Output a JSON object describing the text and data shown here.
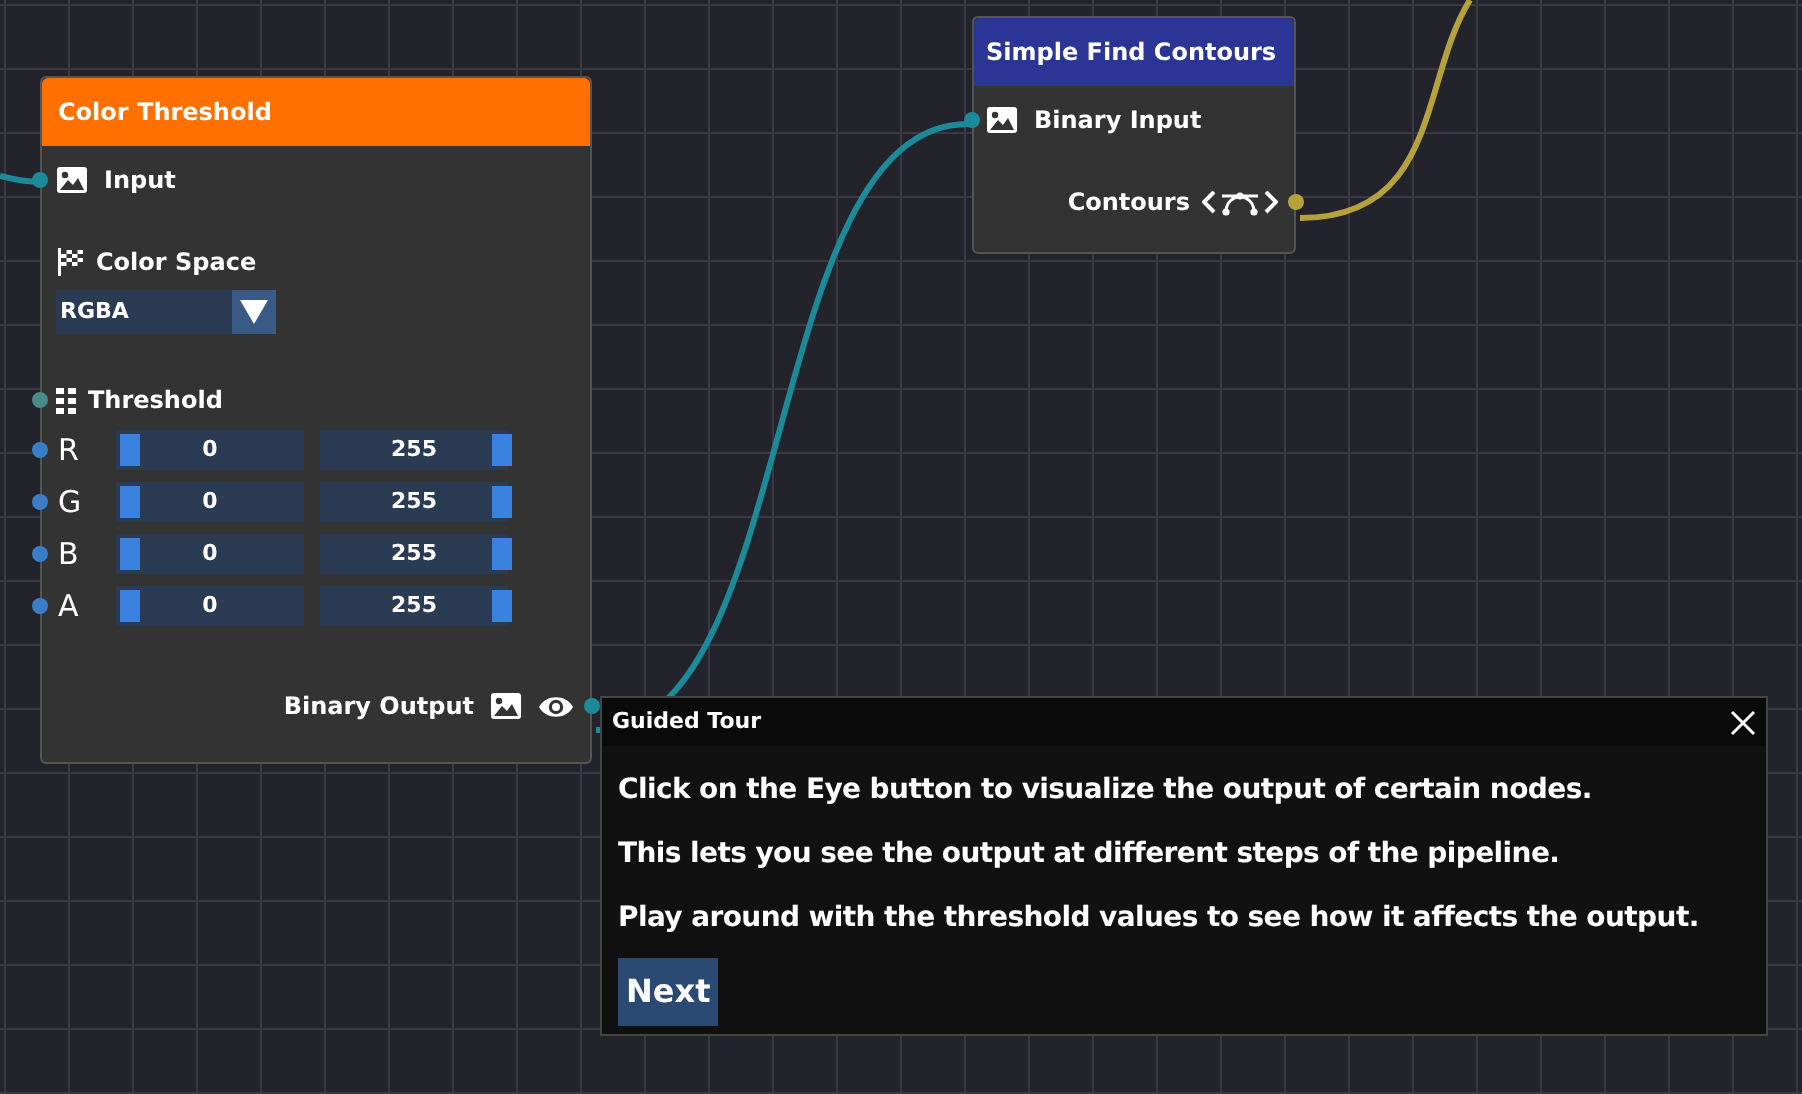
{
  "color_threshold_node": {
    "title": "Color Threshold",
    "input": {
      "label": "Input"
    },
    "color_space": {
      "label": "Color Space",
      "value": "RGBA"
    },
    "threshold": {
      "label": "Threshold",
      "channels": [
        {
          "label": "R",
          "min": {
            "value": "0",
            "level": 0
          },
          "max": {
            "value": "255",
            "level": 1
          }
        },
        {
          "label": "G",
          "min": {
            "value": "0",
            "level": 0
          },
          "max": {
            "value": "255",
            "level": 1
          }
        },
        {
          "label": "B",
          "min": {
            "value": "0",
            "level": 0
          },
          "max": {
            "value": "255",
            "level": 1
          }
        },
        {
          "label": "A",
          "min": {
            "value": "0",
            "level": 0
          },
          "max": {
            "value": "255",
            "level": 1
          }
        }
      ]
    },
    "output": {
      "label": "Binary Output"
    }
  },
  "find_contours_node": {
    "title": "Simple Find Contours",
    "input": {
      "label": "Binary Input"
    },
    "output": {
      "label": "Contours"
    }
  },
  "guided_tour": {
    "title": "Guided Tour",
    "lines": [
      "Click on the Eye button to visualize the output of certain nodes.",
      "This lets you see the output at different steps of the pipeline.",
      "Play around with the threshold values to see how it affects the output."
    ],
    "button": "Next"
  }
}
